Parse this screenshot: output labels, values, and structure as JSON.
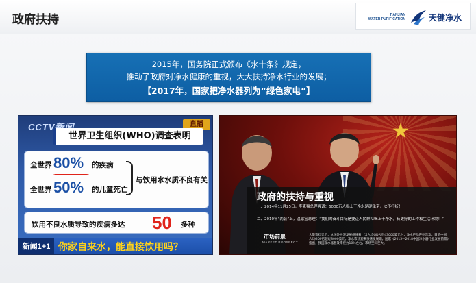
{
  "header": {
    "title": "政府扶持",
    "logo": {
      "tagline_line1": "TIANJIAN",
      "tagline_line2": "WATER PURIFICATION",
      "name": "天健净水"
    }
  },
  "notice": {
    "line1": "2015年，国务院正式颁布《水十条》规定，",
    "line2": "推动了政府对净水健康的重视，大大扶持净水行业的发展；",
    "line3": "【2017年，国家把净水器列为“绿色家电”】"
  },
  "news_clip": {
    "channel_logo": "CCTV新闻",
    "live_badge": "直播",
    "heading": "世界卫生组织(WHO)调查表明",
    "stat1": {
      "prefix": "全世界",
      "number": "80%",
      "suffix": "的疾病"
    },
    "stat2": {
      "prefix": "全世界",
      "number": "50%",
      "suffix": "的儿童死亡"
    },
    "cause": "与饮用水水质不良有关",
    "disease": {
      "label": "饮用不良水质导致的疾病多达",
      "number": "50",
      "unit": "多种"
    },
    "ticker_tag": "新闻1+1",
    "ticker_text": "你家自来水，能直接饮用吗？"
  },
  "poster": {
    "title": "政府的扶持与重视",
    "point1": "一、2014年11月25日，李克强总理强调：6000万人喝上干净水是硬承诺，决不打折！",
    "point2": "二、2010年“两会”上，温家宝总理：“我们的奋斗目标是要让人民群众喝上干净水，有更好的工作和生活环境！”",
    "section_title": "市场前景",
    "section_title_en": "MARKET PROSPECT",
    "body": "大量资料显示，从国外经济发展规律看，当人均GDP超过3000美元时，净水产品开始普及。目前中国人均GDP已超过8000美元，净水市场迎来快速发展期，国家《2015—2018中国净水器行业发展前景》指出，我国净水器普及率仅为10%左右，市场空间巨大。"
  },
  "colors": {
    "notice_blue": "#1770b5",
    "stat_blue": "#1a4fa5",
    "alert_red": "#e0241b",
    "ticker_yellow": "#ffd21a"
  }
}
